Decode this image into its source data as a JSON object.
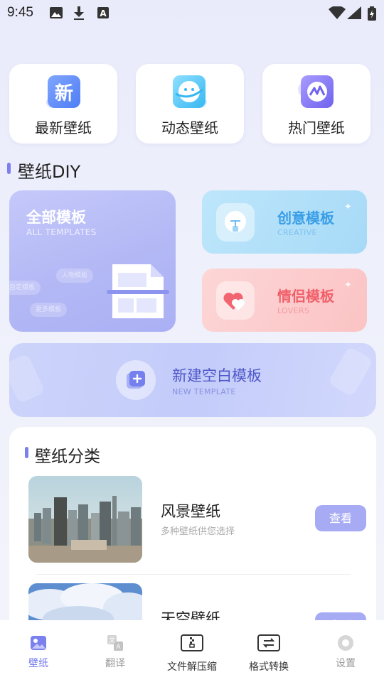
{
  "status_bar": {
    "time": "9:45"
  },
  "top_cards": [
    {
      "label": "最新壁纸",
      "icon": "new-badge-icon",
      "icon_text": "新"
    },
    {
      "label": "动态壁纸",
      "icon": "smile-planet-icon"
    },
    {
      "label": "热门壁纸",
      "icon": "hot-chart-icon"
    }
  ],
  "diy_section": {
    "title": "壁纸DIY"
  },
  "all_templates": {
    "title": "全部模板",
    "subtitle": "ALL TEMPLATES",
    "tags": [
      "人物模板",
      "自定模板",
      "更多模板"
    ]
  },
  "creative": {
    "title": "创意模板",
    "subtitle": "CREATIVE",
    "icon": "lightbulb-icon"
  },
  "lovers": {
    "title": "情侣模板",
    "subtitle": "LOVERS",
    "icon": "hearts-icon"
  },
  "new_template": {
    "title": "新建空白模板",
    "subtitle": "NEW TEMPLATE",
    "icon": "add-template-icon"
  },
  "category_section": {
    "title": "壁纸分类",
    "items": [
      {
        "name": "风景壁纸",
        "desc": "多种壁纸供您选择",
        "button": "查看",
        "thumb": "city-skyline"
      },
      {
        "name": "天空壁纸",
        "desc": "",
        "button": "查看",
        "thumb": "clouds-sky"
      }
    ]
  },
  "bottom_nav": [
    {
      "label": "壁纸",
      "icon": "wallpaper-icon",
      "active": true
    },
    {
      "label": "翻译",
      "icon": "translate-icon",
      "active": false
    },
    {
      "label": "文件解压缩",
      "icon": "zip-file-icon",
      "active": false
    },
    {
      "label": "格式转换",
      "icon": "convert-icon",
      "active": false
    },
    {
      "label": "设置",
      "icon": "settings-icon",
      "active": false
    }
  ],
  "colors": {
    "accent": "#7b7fef",
    "view_button": "#a7abf4",
    "creative_text": "#3a9ee6",
    "lovers_text": "#f0606b",
    "new_template_text": "#4f57c9"
  }
}
